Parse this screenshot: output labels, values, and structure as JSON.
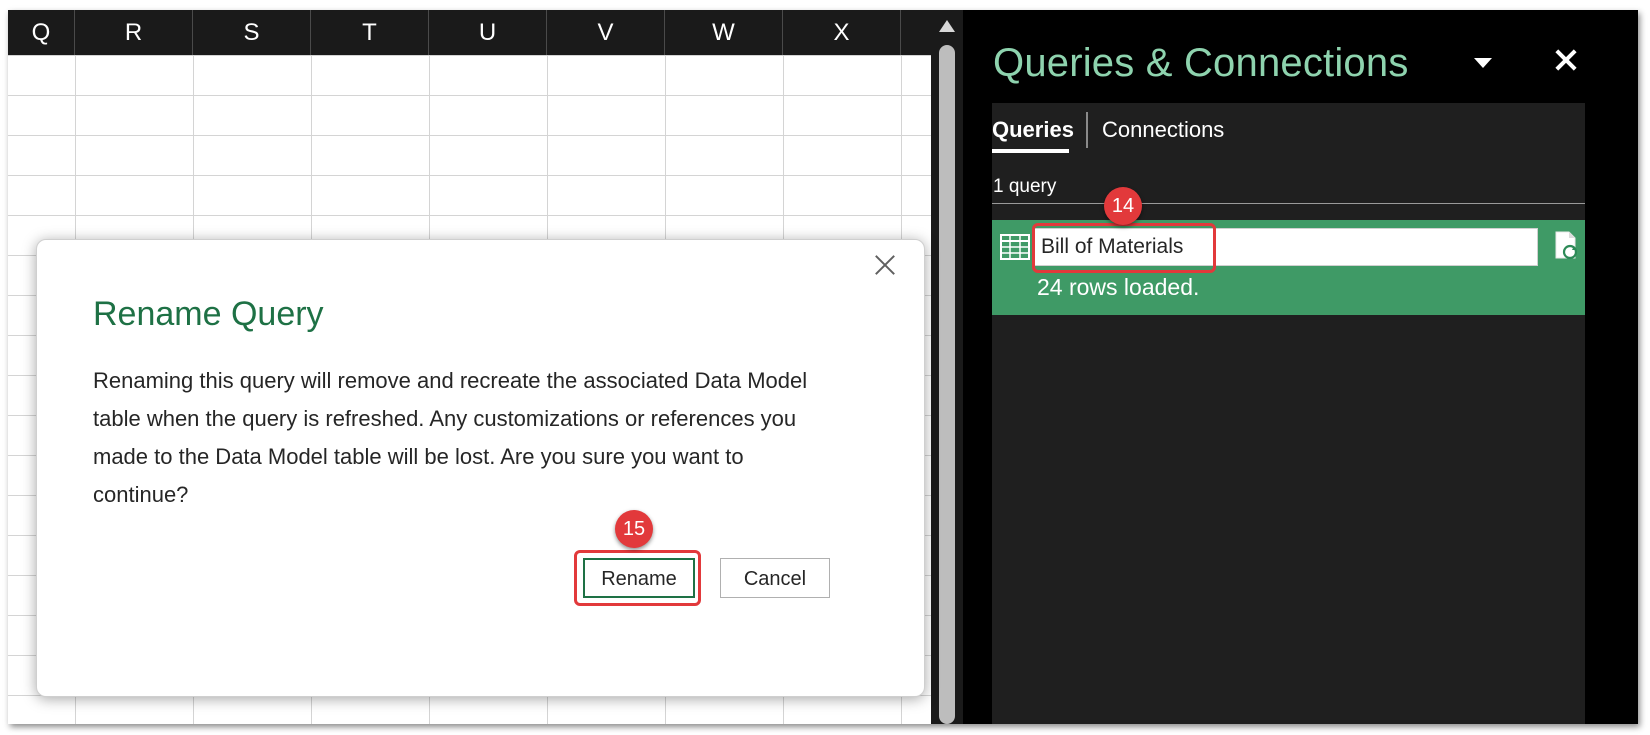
{
  "sheet": {
    "columns": [
      "Q",
      "R",
      "S",
      "T",
      "U",
      "V",
      "W",
      "X"
    ]
  },
  "dialog": {
    "title": "Rename Query",
    "message": "Renaming this query will remove and recreate the associated Data Model table when the query is refreshed. Any customizations or references you made to the Data Model table will be lost. Are you sure you want to continue?",
    "rename_label": "Rename",
    "cancel_label": "Cancel"
  },
  "pane": {
    "title": "Queries & Connections",
    "tabs": [
      {
        "label": "Queries",
        "active": true
      },
      {
        "label": "Connections",
        "active": false
      }
    ],
    "query_count": "1 query",
    "query": {
      "name": "Bill of Materials",
      "status": "24 rows loaded."
    }
  },
  "callouts": [
    {
      "number": "14",
      "target": "query-name-input"
    },
    {
      "number": "15",
      "target": "rename-button"
    }
  ],
  "colors": {
    "accent_green": "#1e7145",
    "pane_title": "#8ed3ae",
    "query_row": "#3f9a66",
    "callout_red": "#e2393b"
  }
}
